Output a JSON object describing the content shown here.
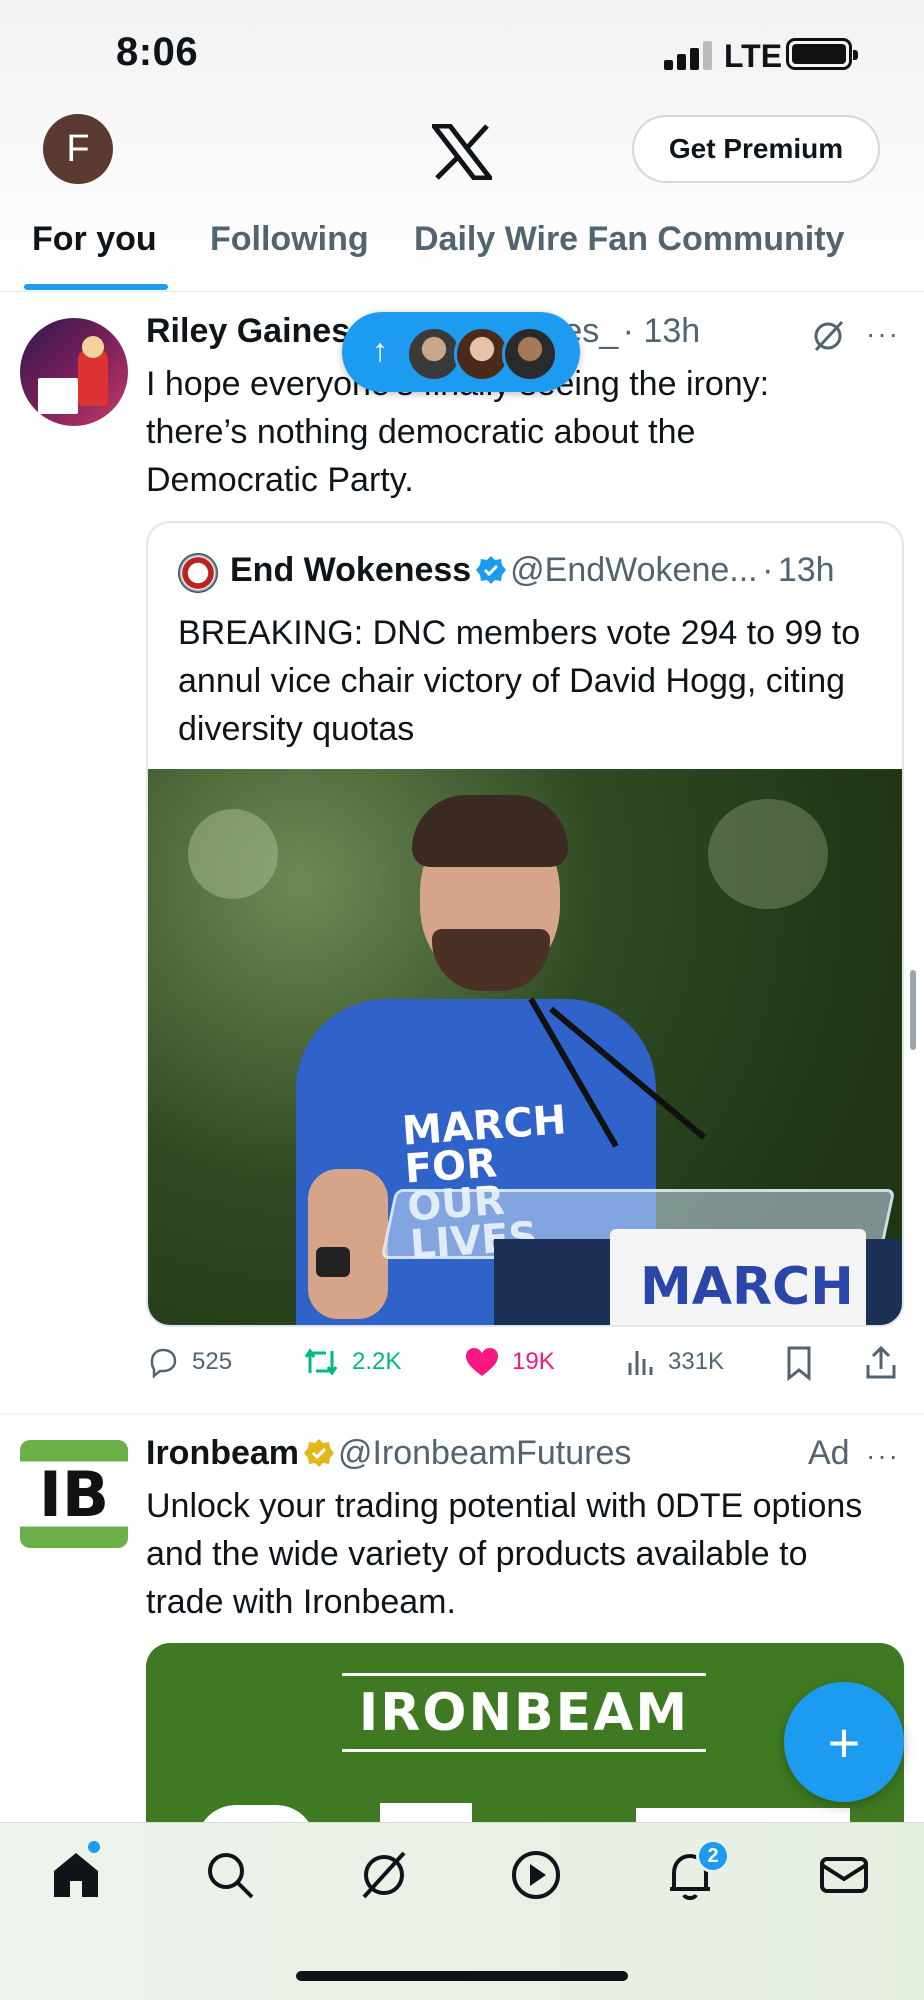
{
  "status": {
    "time": "8:06",
    "network": "LTE"
  },
  "header": {
    "avatar_letter": "F",
    "premium_label": "Get Premium",
    "tabs": [
      {
        "label": "For you"
      },
      {
        "label": "Following"
      },
      {
        "label": "Daily Wire Fan Community"
      }
    ]
  },
  "post1": {
    "name": "Riley Gaines",
    "handle": "@Riley_Gaines_",
    "time": "13h",
    "text": "I hope everyone’s finally seeing the irony: there’s nothing democratic about the Democratic Party.",
    "quote": {
      "name": "End Wokeness",
      "handle": "@EndWokene...",
      "time": "13h",
      "text": "BREAKING: DNC members vote 294 to 99 to annul vice chair victory of David Hogg, citing diversity quotas",
      "image_shirt_text": "MARCH FOR OUR LIVES",
      "image_sign_text": "MARCH"
    },
    "stats": {
      "replies": "525",
      "reposts": "2.2K",
      "likes": "19K",
      "views": "331K"
    }
  },
  "post2": {
    "name": "Ironbeam",
    "handle": "@IronbeamFutures",
    "ad_label": "Ad",
    "avatar_text": "IB",
    "text": "Unlock your trading potential with 0DTE options and the wide variety of products available to trade with Ironbeam.",
    "card_logo": "IRONBEAM"
  },
  "nav": {
    "notifications_badge": "2"
  },
  "colors": {
    "accent": "#1d9bf0",
    "like": "#f91880",
    "repost": "#00ba7c",
    "gold_badge": "#e2b719",
    "ad_green": "#3f7a22"
  }
}
